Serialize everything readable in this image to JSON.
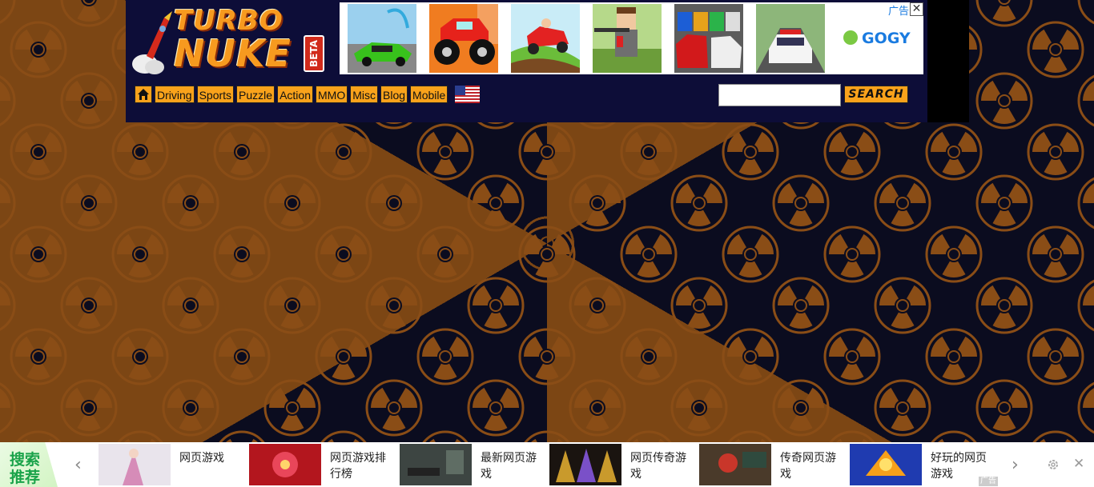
{
  "colors": {
    "background": "#0b0c1f",
    "pattern": "#8a4d16",
    "header": "#0d0d38",
    "nav_button": "#f9a21b",
    "bottom_title": "#1aa34a"
  },
  "logo": {
    "line1": "TURBO",
    "line2": "NUKE",
    "badge": "BETA"
  },
  "ads": {
    "label": "广告",
    "close": "✕",
    "thumbs": [
      "racing-car",
      "monster-truck",
      "hill-climb-car",
      "blocky-sniper",
      "parking-lot-cars",
      "police-car"
    ],
    "brand": "GOGY"
  },
  "nav": {
    "home_icon": "home-icon",
    "items": [
      "Driving",
      "Sports",
      "Puzzle",
      "Action",
      "MMO",
      "Misc",
      "Blog",
      "Mobile"
    ],
    "flag_icon": "us-flag-icon"
  },
  "search": {
    "value": "",
    "button_label": "SEARCH"
  },
  "bottom_bar": {
    "title_line1": "搜索",
    "title_line2": "推荐",
    "prev": "‹",
    "next": "›",
    "items": [
      {
        "text": "网页游戏"
      },
      {
        "text": "网页游戏排行榜"
      },
      {
        "text": "最新网页游戏"
      },
      {
        "text": "网页传奇游戏"
      },
      {
        "text": "传奇网页游戏"
      },
      {
        "text": "好玩的网页游戏"
      }
    ],
    "ad_tag": "广告",
    "close": "✕"
  }
}
